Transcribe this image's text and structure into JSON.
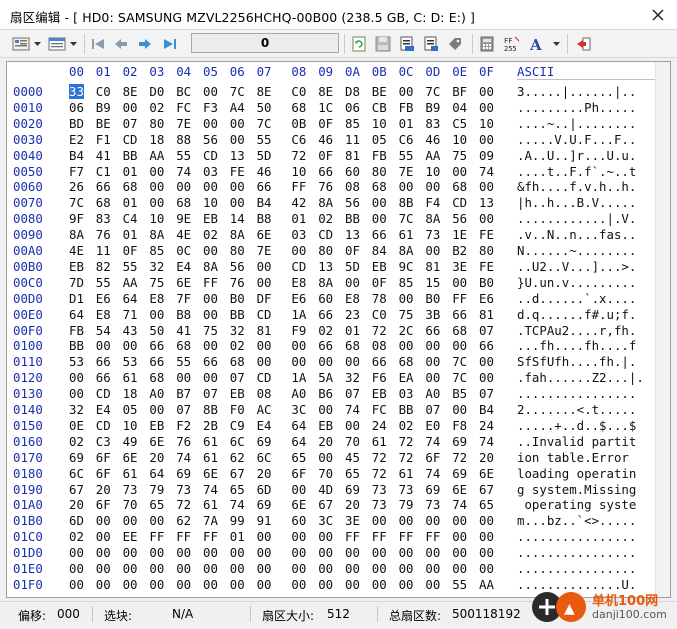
{
  "window": {
    "title": "扇区编辑 - [ HD0: SAMSUNG MZVL2256HCHQ-00B00 (238.5 GB, C: D: E:) ]",
    "close_label": "✕"
  },
  "toolbar": {
    "offset_value": "0",
    "icons": [
      "view-mode-icon",
      "dropdown-icon",
      "layout-icon",
      "dropdown-icon",
      "first-sector-icon",
      "prev-sector-icon",
      "next-sector-icon",
      "last-sector-icon",
      "refresh-icon",
      "save-icon",
      "save-all-icon",
      "export-icon",
      "tag-icon",
      "calculator-icon",
      "checksum-icon",
      "font-icon",
      "dropdown-icon",
      "exit-icon"
    ]
  },
  "hex": {
    "columns": [
      "00",
      "01",
      "02",
      "03",
      "04",
      "05",
      "06",
      "07",
      "08",
      "09",
      "0A",
      "0B",
      "0C",
      "0D",
      "0E",
      "0F"
    ],
    "ascii_header": "ASCII",
    "rows": [
      {
        "addr": "0000",
        "bytes": [
          "33",
          "C0",
          "8E",
          "D0",
          "BC",
          "00",
          "7C",
          "8E",
          "C0",
          "8E",
          "D8",
          "BE",
          "00",
          "7C",
          "BF",
          "00"
        ],
        "ascii": "3.....|......|.."
      },
      {
        "addr": "0010",
        "bytes": [
          "06",
          "B9",
          "00",
          "02",
          "FC",
          "F3",
          "A4",
          "50",
          "68",
          "1C",
          "06",
          "CB",
          "FB",
          "B9",
          "04",
          "00"
        ],
        "ascii": ".........Ph....."
      },
      {
        "addr": "0020",
        "bytes": [
          "BD",
          "BE",
          "07",
          "80",
          "7E",
          "00",
          "00",
          "7C",
          "0B",
          "0F",
          "85",
          "10",
          "01",
          "83",
          "C5",
          "10"
        ],
        "ascii": "....~..|........"
      },
      {
        "addr": "0030",
        "bytes": [
          "E2",
          "F1",
          "CD",
          "18",
          "88",
          "56",
          "00",
          "55",
          "C6",
          "46",
          "11",
          "05",
          "C6",
          "46",
          "10",
          "00"
        ],
        "ascii": ".....V.U.F...F.."
      },
      {
        "addr": "0040",
        "bytes": [
          "B4",
          "41",
          "BB",
          "AA",
          "55",
          "CD",
          "13",
          "5D",
          "72",
          "0F",
          "81",
          "FB",
          "55",
          "AA",
          "75",
          "09"
        ],
        "ascii": ".A..U..]r...U.u."
      },
      {
        "addr": "0050",
        "bytes": [
          "F7",
          "C1",
          "01",
          "00",
          "74",
          "03",
          "FE",
          "46",
          "10",
          "66",
          "60",
          "80",
          "7E",
          "10",
          "00",
          "74"
        ],
        "ascii": "....t..F.f`.~..t"
      },
      {
        "addr": "0060",
        "bytes": [
          "26",
          "66",
          "68",
          "00",
          "00",
          "00",
          "00",
          "66",
          "FF",
          "76",
          "08",
          "68",
          "00",
          "00",
          "68",
          "00"
        ],
        "ascii": "&fh....f.v.h..h."
      },
      {
        "addr": "0070",
        "bytes": [
          "7C",
          "68",
          "01",
          "00",
          "68",
          "10",
          "00",
          "B4",
          "42",
          "8A",
          "56",
          "00",
          "8B",
          "F4",
          "CD",
          "13"
        ],
        "ascii": "|h..h...B.V....."
      },
      {
        "addr": "0080",
        "bytes": [
          "9F",
          "83",
          "C4",
          "10",
          "9E",
          "EB",
          "14",
          "B8",
          "01",
          "02",
          "BB",
          "00",
          "7C",
          "8A",
          "56",
          "00"
        ],
        "ascii": "............|.V."
      },
      {
        "addr": "0090",
        "bytes": [
          "8A",
          "76",
          "01",
          "8A",
          "4E",
          "02",
          "8A",
          "6E",
          "03",
          "CD",
          "13",
          "66",
          "61",
          "73",
          "1E",
          "FE"
        ],
        "ascii": ".v..N..n...fas.."
      },
      {
        "addr": "00A0",
        "bytes": [
          "4E",
          "11",
          "0F",
          "85",
          "0C",
          "00",
          "80",
          "7E",
          "00",
          "80",
          "0F",
          "84",
          "8A",
          "00",
          "B2",
          "80"
        ],
        "ascii": "N......~........"
      },
      {
        "addr": "00B0",
        "bytes": [
          "EB",
          "82",
          "55",
          "32",
          "E4",
          "8A",
          "56",
          "00",
          "CD",
          "13",
          "5D",
          "EB",
          "9C",
          "81",
          "3E",
          "FE"
        ],
        "ascii": "..U2..V...]...>."
      },
      {
        "addr": "00C0",
        "bytes": [
          "7D",
          "55",
          "AA",
          "75",
          "6E",
          "FF",
          "76",
          "00",
          "E8",
          "8A",
          "00",
          "0F",
          "85",
          "15",
          "00",
          "B0"
        ],
        "ascii": "}U.un.v........."
      },
      {
        "addr": "00D0",
        "bytes": [
          "D1",
          "E6",
          "64",
          "E8",
          "7F",
          "00",
          "B0",
          "DF",
          "E6",
          "60",
          "E8",
          "78",
          "00",
          "B0",
          "FF",
          "E6"
        ],
        "ascii": "..d......`.x...."
      },
      {
        "addr": "00E0",
        "bytes": [
          "64",
          "E8",
          "71",
          "00",
          "B8",
          "00",
          "BB",
          "CD",
          "1A",
          "66",
          "23",
          "C0",
          "75",
          "3B",
          "66",
          "81"
        ],
        "ascii": "d.q......f#.u;f."
      },
      {
        "addr": "00F0",
        "bytes": [
          "FB",
          "54",
          "43",
          "50",
          "41",
          "75",
          "32",
          "81",
          "F9",
          "02",
          "01",
          "72",
          "2C",
          "66",
          "68",
          "07"
        ],
        "ascii": ".TCPAu2....r,fh."
      },
      {
        "addr": "0100",
        "bytes": [
          "BB",
          "00",
          "00",
          "66",
          "68",
          "00",
          "02",
          "00",
          "00",
          "66",
          "68",
          "08",
          "00",
          "00",
          "00",
          "66"
        ],
        "ascii": "...fh....fh....f"
      },
      {
        "addr": "0110",
        "bytes": [
          "53",
          "66",
          "53",
          "66",
          "55",
          "66",
          "68",
          "00",
          "00",
          "00",
          "00",
          "66",
          "68",
          "00",
          "7C",
          "00"
        ],
        "ascii": "SfSfUfh....fh.|."
      },
      {
        "addr": "0120",
        "bytes": [
          "00",
          "66",
          "61",
          "68",
          "00",
          "00",
          "07",
          "CD",
          "1A",
          "5A",
          "32",
          "F6",
          "EA",
          "00",
          "7C",
          "00"
        ],
        "ascii": ".fah......Z2...|."
      },
      {
        "addr": "0130",
        "bytes": [
          "00",
          "CD",
          "18",
          "A0",
          "B7",
          "07",
          "EB",
          "08",
          "A0",
          "B6",
          "07",
          "EB",
          "03",
          "A0",
          "B5",
          "07"
        ],
        "ascii": "................"
      },
      {
        "addr": "0140",
        "bytes": [
          "32",
          "E4",
          "05",
          "00",
          "07",
          "8B",
          "F0",
          "AC",
          "3C",
          "00",
          "74",
          "FC",
          "BB",
          "07",
          "00",
          "B4"
        ],
        "ascii": "2.......<.t....."
      },
      {
        "addr": "0150",
        "bytes": [
          "0E",
          "CD",
          "10",
          "EB",
          "F2",
          "2B",
          "C9",
          "E4",
          "64",
          "EB",
          "00",
          "24",
          "02",
          "E0",
          "F8",
          "24"
        ],
        "ascii": ".....+..d..$...$"
      },
      {
        "addr": "0160",
        "bytes": [
          "02",
          "C3",
          "49",
          "6E",
          "76",
          "61",
          "6C",
          "69",
          "64",
          "20",
          "70",
          "61",
          "72",
          "74",
          "69",
          "74"
        ],
        "ascii": "..Invalid partit"
      },
      {
        "addr": "0170",
        "bytes": [
          "69",
          "6F",
          "6E",
          "20",
          "74",
          "61",
          "62",
          "6C",
          "65",
          "00",
          "45",
          "72",
          "72",
          "6F",
          "72",
          "20"
        ],
        "ascii": "ion table.Error "
      },
      {
        "addr": "0180",
        "bytes": [
          "6C",
          "6F",
          "61",
          "64",
          "69",
          "6E",
          "67",
          "20",
          "6F",
          "70",
          "65",
          "72",
          "61",
          "74",
          "69",
          "6E"
        ],
        "ascii": "loading operatin"
      },
      {
        "addr": "0190",
        "bytes": [
          "67",
          "20",
          "73",
          "79",
          "73",
          "74",
          "65",
          "6D",
          "00",
          "4D",
          "69",
          "73",
          "73",
          "69",
          "6E",
          "67"
        ],
        "ascii": "g system.Missing"
      },
      {
        "addr": "01A0",
        "bytes": [
          "20",
          "6F",
          "70",
          "65",
          "72",
          "61",
          "74",
          "69",
          "6E",
          "67",
          "20",
          "73",
          "79",
          "73",
          "74",
          "65"
        ],
        "ascii": " operating syste"
      },
      {
        "addr": "01B0",
        "bytes": [
          "6D",
          "00",
          "00",
          "00",
          "62",
          "7A",
          "99",
          "91",
          "60",
          "3C",
          "3E",
          "00",
          "00",
          "00",
          "00",
          "00"
        ],
        "ascii": "m...bz..`<>....."
      },
      {
        "addr": "01C0",
        "bytes": [
          "02",
          "00",
          "EE",
          "FF",
          "FF",
          "FF",
          "01",
          "00",
          "00",
          "00",
          "FF",
          "FF",
          "FF",
          "FF",
          "00",
          "00"
        ],
        "ascii": "................"
      },
      {
        "addr": "01D0",
        "bytes": [
          "00",
          "00",
          "00",
          "00",
          "00",
          "00",
          "00",
          "00",
          "00",
          "00",
          "00",
          "00",
          "00",
          "00",
          "00",
          "00"
        ],
        "ascii": "................"
      },
      {
        "addr": "01E0",
        "bytes": [
          "00",
          "00",
          "00",
          "00",
          "00",
          "00",
          "00",
          "00",
          "00",
          "00",
          "00",
          "00",
          "00",
          "00",
          "00",
          "00"
        ],
        "ascii": "................"
      },
      {
        "addr": "01F0",
        "bytes": [
          "00",
          "00",
          "00",
          "00",
          "00",
          "00",
          "00",
          "00",
          "00",
          "00",
          "00",
          "00",
          "00",
          "00",
          "55",
          "AA"
        ],
        "ascii": "..............U."
      }
    ]
  },
  "status": {
    "offset_label": "偏移:",
    "offset_value": "000",
    "selection_label": "选块:",
    "selection_value": "N/A",
    "sector_size_label": "扇区大小:",
    "sector_size_value": "512",
    "total_sectors_label": "总扇区数:",
    "total_sectors_value": "500118192"
  },
  "watermark": {
    "brand": "单机100网",
    "domain": "danji100.com"
  }
}
